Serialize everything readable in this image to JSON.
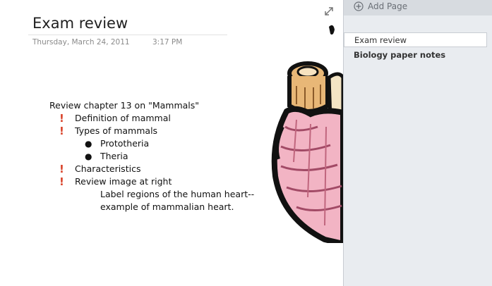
{
  "page": {
    "title": "Exam review",
    "date": "Thursday, March 24, 2011",
    "time": "3:17 PM"
  },
  "notes": {
    "heading": "Review chapter 13 on \"Mammals\"",
    "items": [
      {
        "text": "Definition of mammal",
        "tag": "important"
      },
      {
        "text": "Types of mammals",
        "tag": "important"
      },
      {
        "text": "Prototheria",
        "tag": "bullet"
      },
      {
        "text": "Theria",
        "tag": "bullet"
      },
      {
        "text": "Characteristics",
        "tag": "important"
      },
      {
        "text": "Review image at right",
        "tag": "important"
      },
      {
        "text": "Label regions of the human heart--",
        "tag": "none"
      },
      {
        "text": "example of mammalian heart.",
        "tag": "none"
      }
    ]
  },
  "pane": {
    "add_page_label": "Add Page",
    "pages": [
      {
        "label": "Exam review",
        "selected": true
      },
      {
        "label": "Biology paper notes",
        "selected": false
      }
    ]
  },
  "icons": {
    "important": "exclamation-icon",
    "bullet": "bullet-dot",
    "expand": "expand-diagonal-arrows-icon",
    "add_page": "plus-circle-icon"
  },
  "colors": {
    "important_tag": "#d9432a",
    "pane_background": "#e9ecf0",
    "heart_pink": "#f2b4c4",
    "heart_tan": "#e8b777"
  }
}
